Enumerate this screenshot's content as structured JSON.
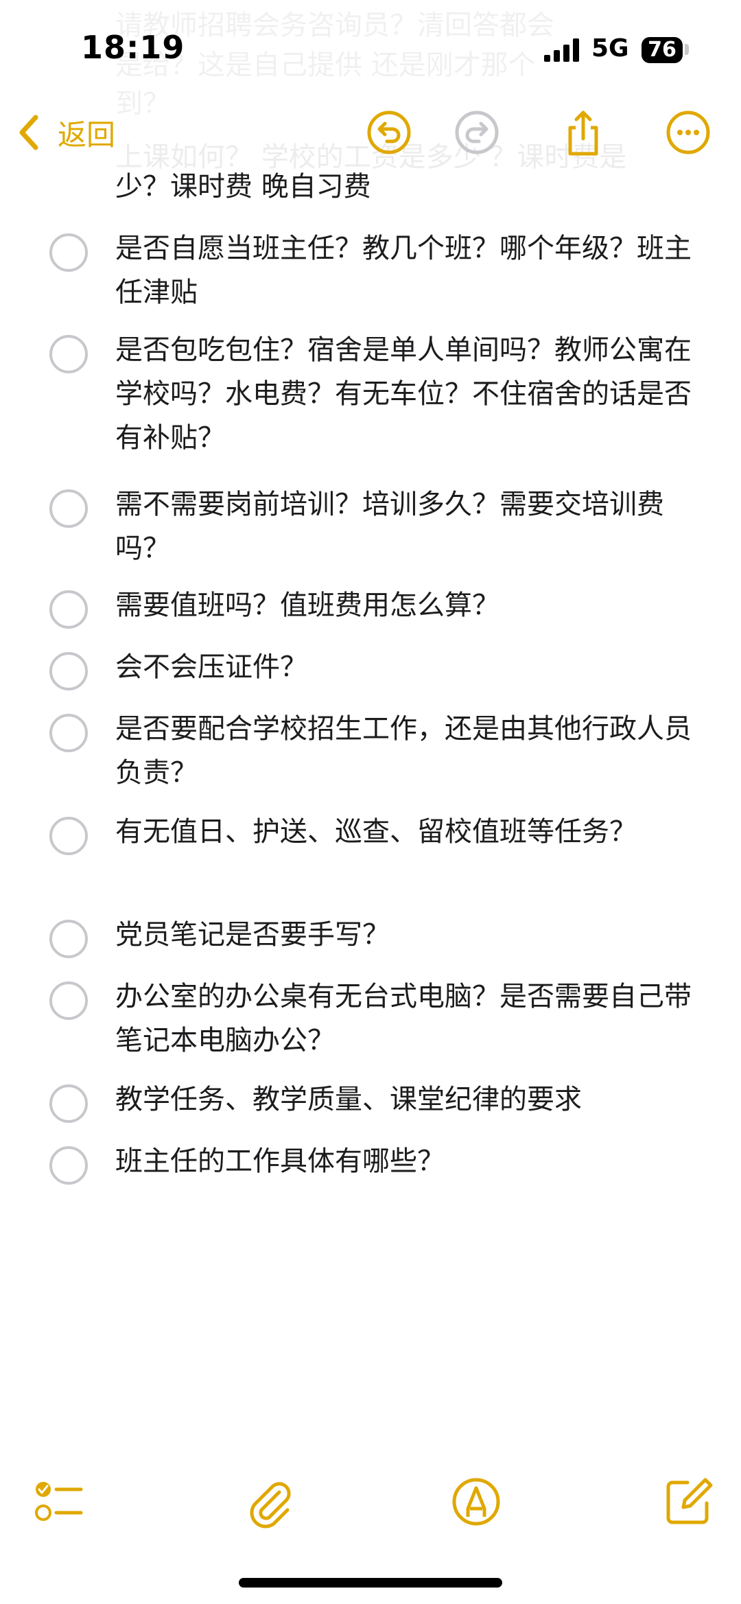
{
  "status_bar": {
    "time": "18:19",
    "network": "5G",
    "battery": "76"
  },
  "top_bleed": {
    "line1": "请教师招聘会务咨询员？清回答都会",
    "line2": "是给？这是自己提供 还是刚才那个",
    "line3": "到？"
  },
  "nav": {
    "back_label": "返回",
    "accent_color": "#e0a800"
  },
  "partial_item": {
    "ghost_line": "上课如何？ 学校的工资是多少 ？课时费是",
    "text": "少？课时费 晚自习费"
  },
  "checklist": [
    {
      "text": "是否自愿当班主任？教几个班？哪个年级？班主任津贴"
    },
    {
      "text": "是否包吃包住？宿舍是单人单间吗？教师公寓在学校吗？水电费？有无车位？不住宿舍的话是否有补贴？"
    },
    {
      "text": "需不需要岗前培训？培训多久？需要交培训费吗？"
    },
    {
      "text": "需要值班吗？值班费用怎么算？"
    },
    {
      "text": "会不会压证件？"
    },
    {
      "text": "是否要配合学校招生工作，还是由其他行政人员负责？"
    },
    {
      "text": "有无值日、护送、巡查、留校值班等任务？"
    },
    {
      "text": "党员笔记是否要手写？"
    },
    {
      "text": "办公室的办公桌有无台式电脑？是否需要自己带笔记本电脑办公？"
    },
    {
      "text": "教学任务、教学质量、课堂纪律的要求"
    },
    {
      "text": "班主任的工作具体有哪些？"
    }
  ]
}
